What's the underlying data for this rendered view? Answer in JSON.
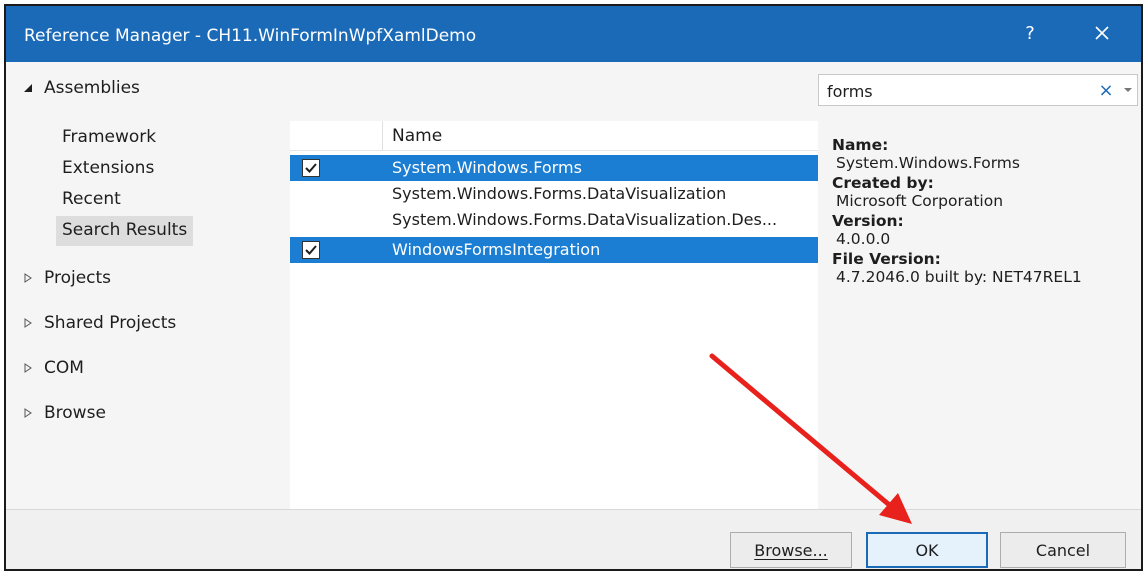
{
  "window": {
    "title": "Reference Manager - CH11.WinFormInWpfXamlDemo",
    "help_glyph": "?",
    "close_icon": "close-icon"
  },
  "nav": {
    "assemblies": "Assemblies",
    "assemblies_items": [
      "Framework",
      "Extensions",
      "Recent",
      "Search Results"
    ],
    "selected_item": "Search Results",
    "groups": [
      "Projects",
      "Shared Projects",
      "COM",
      "Browse"
    ]
  },
  "search": {
    "value": "forms",
    "clear_glyph": "×",
    "dropdown_icon": "chevron-down-icon"
  },
  "list": {
    "column_name": "Name",
    "rows": [
      {
        "name": "System.Windows.Forms",
        "checked": true,
        "selected": true
      },
      {
        "name": "System.Windows.Forms.DataVisualization",
        "checked": false,
        "selected": false
      },
      {
        "name": "System.Windows.Forms.DataVisualization.Des...",
        "checked": false,
        "selected": false
      },
      {
        "name": "WindowsFormsIntegration",
        "checked": true,
        "selected": true
      }
    ]
  },
  "details": {
    "name_label": "Name:",
    "name_value": "System.Windows.Forms",
    "created_label": "Created by:",
    "created_value": "Microsoft Corporation",
    "version_label": "Version:",
    "version_value": "4.0.0.0",
    "file_version_label": "File Version:",
    "file_version_value": "4.7.2046.0 built by: NET47REL1"
  },
  "footer": {
    "browse_label": "Browse...",
    "ok_label": "OK",
    "cancel_label": "Cancel"
  },
  "colors": {
    "titlebar": "#1b6ab8",
    "selection": "#1b7ed3",
    "annotation_arrow": "#e8211c"
  }
}
